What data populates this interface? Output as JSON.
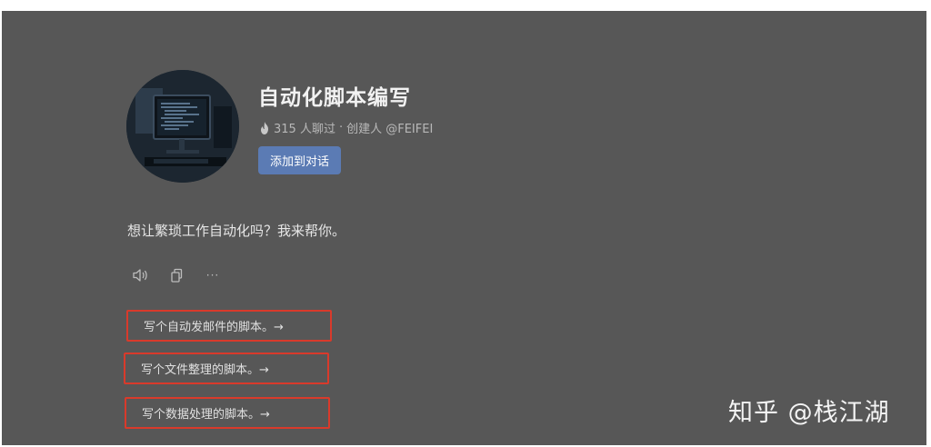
{
  "bot": {
    "title": "自动化脚本编写",
    "chat_count_text": "315 人聊过",
    "separator": "·",
    "creator_text": "创建人 @FEIFEI",
    "add_button_label": "添加到对话",
    "greeting": "想让繁琐工作自动化吗？我来帮你。"
  },
  "actions": [
    {
      "icon": "speaker-icon"
    },
    {
      "icon": "copy-icon"
    },
    {
      "icon": "more-icon",
      "label": "···"
    }
  ],
  "suggestions": [
    {
      "label": "写个自动发邮件的脚本。→"
    },
    {
      "label": "写个文件整理的脚本。→"
    },
    {
      "label": "写个数据处理的脚本。→"
    }
  ],
  "watermark": "知乎 @栈江湖",
  "colors": {
    "panel_bg": "#575757",
    "button_bg": "#5b7bb4",
    "highlight_border": "#d93a2b"
  }
}
